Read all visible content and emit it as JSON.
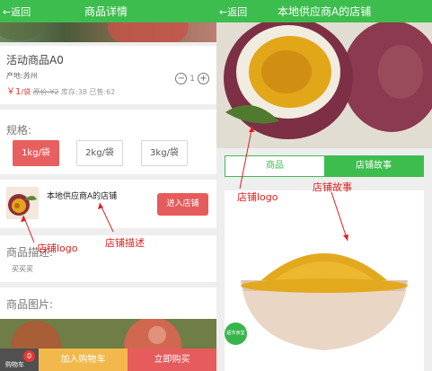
{
  "left_screen": {
    "header": {
      "back_label": "←返回",
      "title": "商品详情"
    },
    "product": {
      "name": "活动商品A0",
      "origin": "产地:苏州",
      "price": "￥1",
      "unit": "/袋",
      "original_price": "原价:¥2",
      "stock": "库存:38",
      "sold": "已售:62",
      "quantity": "1",
      "minus_label": "−",
      "plus_label": "+"
    },
    "spec": {
      "label": "规格:",
      "options": [
        "1kg/袋",
        "2kg/袋",
        "3kg/袋"
      ],
      "selected": "1kg/袋"
    },
    "store": {
      "name": "本地供应商A的店铺",
      "enter_button": "进入店铺"
    },
    "description": {
      "label": "商品描述:",
      "text": "买买买"
    },
    "images_label": "商品图片:",
    "bottom_bar": {
      "cart_label": "购物车",
      "cart_count": "0",
      "add_to_cart": "加入购物车",
      "buy_now": "立即购买"
    },
    "annotations": {
      "store_logo": "店铺logo",
      "store_desc": "店铺描述"
    }
  },
  "right_screen": {
    "header": {
      "back_label": "←返回",
      "title": "本地供应商A的店铺"
    },
    "tabs": [
      "商品",
      "店铺故事"
    ],
    "active_tab": "店铺故事",
    "badge_text": "超市食堂",
    "annotations": {
      "store_logo": "店铺logo",
      "store_story": "店铺故事"
    }
  },
  "colors": {
    "header_green": "#3dbd4e",
    "accent_red": "#e65b5b",
    "add_cart_orange": "#f2b84b",
    "annotation_red": "#e02020"
  },
  "icons": [
    "back-arrow-icon",
    "minus-circle-icon",
    "plus-circle-icon",
    "cart-icon",
    "arrow-annotation-icon"
  ]
}
